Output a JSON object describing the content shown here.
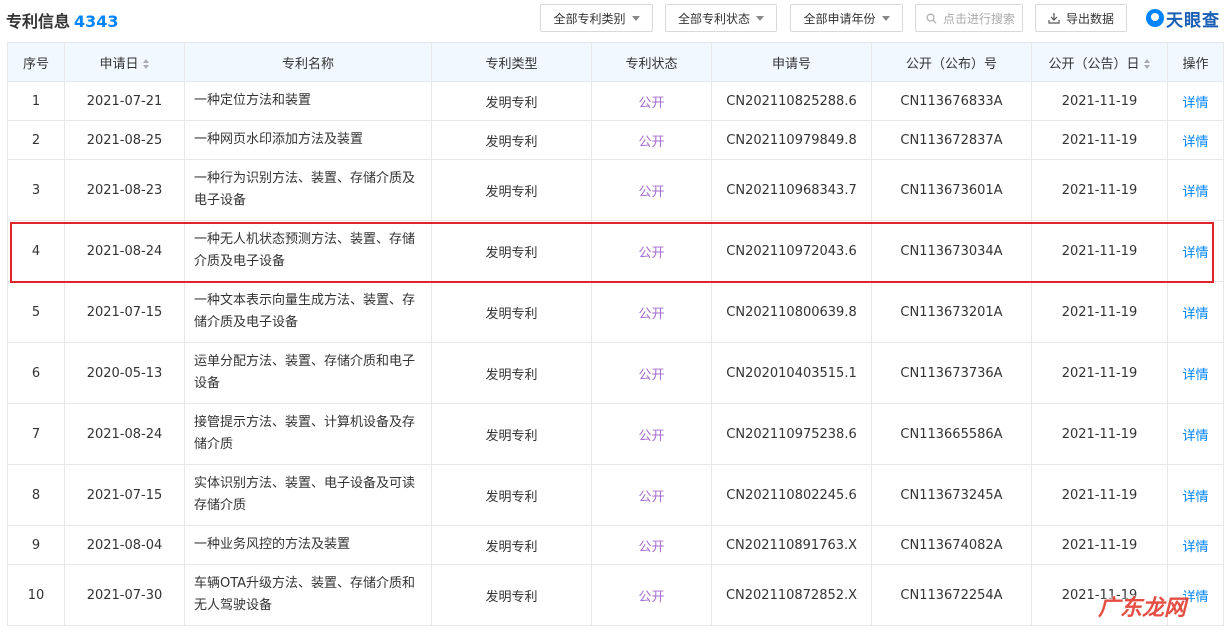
{
  "header": {
    "title": "专利信息",
    "count": "4343",
    "filter_category": "全部专利类别",
    "filter_status": "全部专利状态",
    "filter_year": "全部申请年份",
    "search_placeholder": "点击进行搜索",
    "export_label": "导出数据",
    "logo_text": "天眼查"
  },
  "table": {
    "columns": [
      "序号",
      "申请日",
      "专利名称",
      "专利类型",
      "专利状态",
      "申请号",
      "公开（公布）号",
      "公开（公告）日",
      "操作"
    ],
    "rows": [
      {
        "no": "1",
        "date": "2021-07-21",
        "name": "一种定位方法和装置",
        "type": "发明专利",
        "status": "公开",
        "app_no": "CN202110825288.6",
        "pub_no": "CN113676833A",
        "pub_date": "2021-11-19",
        "action": "详情"
      },
      {
        "no": "2",
        "date": "2021-08-25",
        "name": "一种网页水印添加方法及装置",
        "type": "发明专利",
        "status": "公开",
        "app_no": "CN202110979849.8",
        "pub_no": "CN113672837A",
        "pub_date": "2021-11-19",
        "action": "详情"
      },
      {
        "no": "3",
        "date": "2021-08-23",
        "name": "一种行为识别方法、装置、存储介质及电子设备",
        "type": "发明专利",
        "status": "公开",
        "app_no": "CN202110968343.7",
        "pub_no": "CN113673601A",
        "pub_date": "2021-11-19",
        "action": "详情"
      },
      {
        "no": "4",
        "date": "2021-08-24",
        "name": "一种无人机状态预测方法、装置、存储介质及电子设备",
        "type": "发明专利",
        "status": "公开",
        "app_no": "CN202110972043.6",
        "pub_no": "CN113673034A",
        "pub_date": "2021-11-19",
        "action": "详情"
      },
      {
        "no": "5",
        "date": "2021-07-15",
        "name": "一种文本表示向量生成方法、装置、存储介质及电子设备",
        "type": "发明专利",
        "status": "公开",
        "app_no": "CN202110800639.8",
        "pub_no": "CN113673201A",
        "pub_date": "2021-11-19",
        "action": "详情"
      },
      {
        "no": "6",
        "date": "2020-05-13",
        "name": "运单分配方法、装置、存储介质和电子设备",
        "type": "发明专利",
        "status": "公开",
        "app_no": "CN202010403515.1",
        "pub_no": "CN113673736A",
        "pub_date": "2021-11-19",
        "action": "详情"
      },
      {
        "no": "7",
        "date": "2021-08-24",
        "name": "接管提示方法、装置、计算机设备及存储介质",
        "type": "发明专利",
        "status": "公开",
        "app_no": "CN202110975238.6",
        "pub_no": "CN113665586A",
        "pub_date": "2021-11-19",
        "action": "详情"
      },
      {
        "no": "8",
        "date": "2021-07-15",
        "name": "实体识别方法、装置、电子设备及可读存储介质",
        "type": "发明专利",
        "status": "公开",
        "app_no": "CN202110802245.6",
        "pub_no": "CN113673245A",
        "pub_date": "2021-11-19",
        "action": "详情"
      },
      {
        "no": "9",
        "date": "2021-08-04",
        "name": "一种业务风控的方法及装置",
        "type": "发明专利",
        "status": "公开",
        "app_no": "CN202110891763.X",
        "pub_no": "CN113674082A",
        "pub_date": "2021-11-19",
        "action": "详情"
      },
      {
        "no": "10",
        "date": "2021-07-30",
        "name": "车辆OTA升级方法、装置、存储介质和无人驾驶设备",
        "type": "发明专利",
        "status": "公开",
        "app_no": "CN202110872852.X",
        "pub_no": "CN113672254A",
        "pub_date": "2021-11-19",
        "action": "详情"
      }
    ]
  },
  "watermark": "广东龙网",
  "colors": {
    "accent": "#0084ff",
    "status": "#a66bd0",
    "highlight": "#e0242b",
    "header_bg": "#f2f8ff"
  }
}
